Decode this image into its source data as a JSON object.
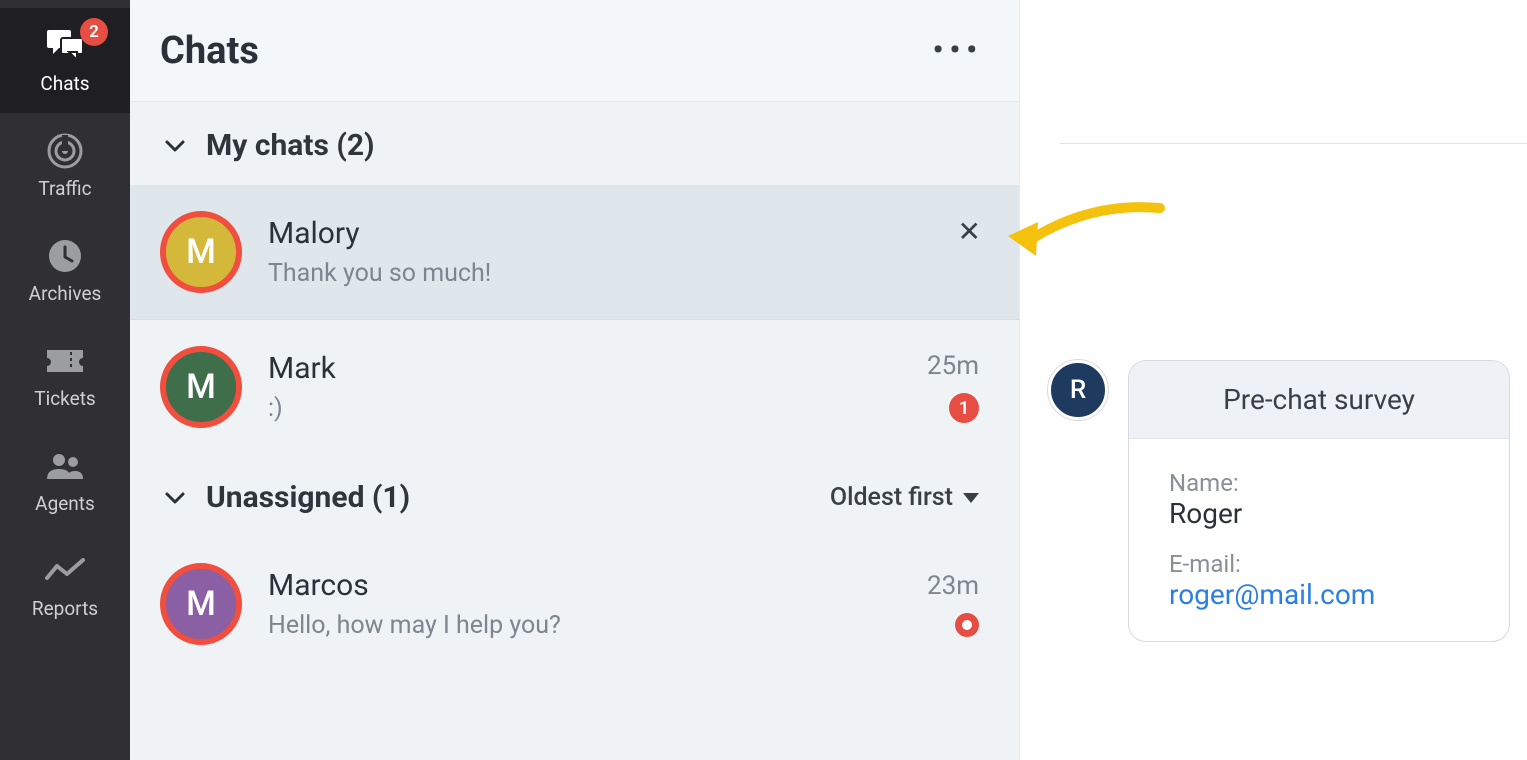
{
  "nav": {
    "items": [
      {
        "key": "chats",
        "label": "Chats",
        "badge": "2",
        "active": true
      },
      {
        "key": "traffic",
        "label": "Traffic"
      },
      {
        "key": "archives",
        "label": "Archives"
      },
      {
        "key": "tickets",
        "label": "Tickets"
      },
      {
        "key": "agents",
        "label": "Agents"
      },
      {
        "key": "reports",
        "label": "Reports"
      }
    ]
  },
  "chatlist": {
    "title": "Chats",
    "sections": {
      "mychats": {
        "title": "My chats (2)",
        "items": [
          {
            "initial": "M",
            "name": "Malory",
            "preview": "Thank you so much!",
            "avatar_bg": "#d4b83a",
            "selected": true,
            "has_close": true
          },
          {
            "initial": "M",
            "name": "Mark",
            "preview": ":)",
            "time": "25m",
            "unread": "1",
            "avatar_bg": "#3f6e4a"
          }
        ]
      },
      "unassigned": {
        "title": "Unassigned (1)",
        "sort_label": "Oldest first",
        "items": [
          {
            "initial": "M",
            "name": "Marcos",
            "preview": "Hello, how may I help you?",
            "time": "23m",
            "dot": true,
            "avatar_bg": "#8b5fa3"
          }
        ]
      }
    }
  },
  "survey": {
    "avatar_initial": "R",
    "title": "Pre-chat survey",
    "name_label": "Name:",
    "name_value": "Roger",
    "email_label": "E-mail:",
    "email_value": "roger@mail.com"
  }
}
